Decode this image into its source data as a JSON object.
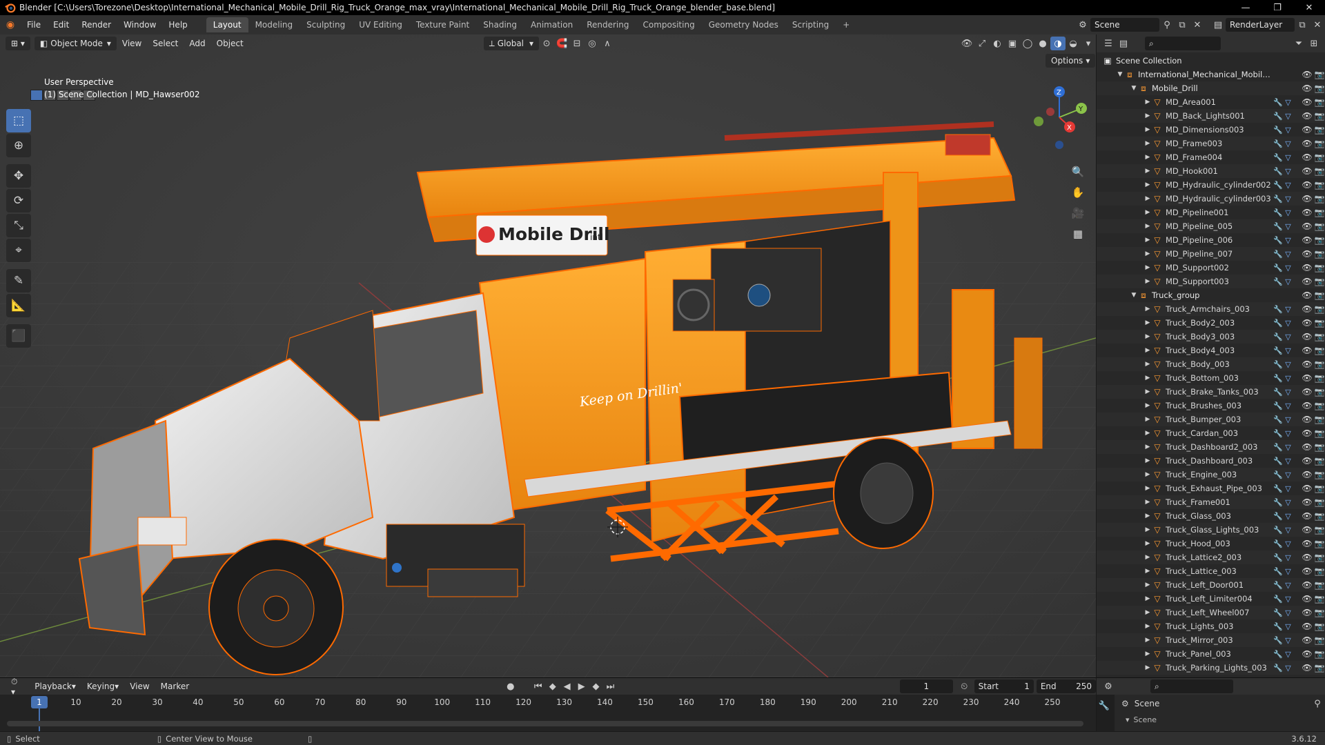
{
  "window": {
    "title": "Blender [C:\\Users\\Torezone\\Desktop\\International_Mechanical_Mobile_Drill_Rig_Truck_Orange_max_vray\\International_Mechanical_Mobile_Drill_Rig_Truck_Orange_blender_base.blend]"
  },
  "menu": [
    "File",
    "Edit",
    "Render",
    "Window",
    "Help"
  ],
  "workspaces": [
    "Layout",
    "Modeling",
    "Sculpting",
    "UV Editing",
    "Texture Paint",
    "Shading",
    "Animation",
    "Rendering",
    "Compositing",
    "Geometry Nodes",
    "Scripting"
  ],
  "active_workspace": "Layout",
  "scene_field": "Scene",
  "renderlayer_field": "RenderLayer",
  "viewport": {
    "mode": "Object Mode",
    "menus": [
      "View",
      "Select",
      "Add",
      "Object"
    ],
    "transform_orientation": "Global",
    "options_label": "Options",
    "info_line1": "User Perspective",
    "info_line2": "(1) Scene Collection | MD_Hawser002",
    "logo_text": "Mobile Drill",
    "logo_suffix": "intl",
    "door_text": "Keep on Drillin'",
    "gizmo": {
      "z": "Z",
      "y": "Y",
      "x": "X"
    }
  },
  "outliner": {
    "root": "Scene Collection",
    "items": [
      {
        "label": "International_Mechanical_Mobile_Drill_R",
        "depth": 1,
        "type": "collection",
        "expanded": true
      },
      {
        "label": "Mobile_Drill",
        "depth": 2,
        "type": "collection",
        "expanded": true
      },
      {
        "label": "MD_Area001",
        "depth": 3,
        "type": "object"
      },
      {
        "label": "MD_Back_Lights001",
        "depth": 3,
        "type": "object"
      },
      {
        "label": "MD_Dimensions003",
        "depth": 3,
        "type": "object"
      },
      {
        "label": "MD_Frame003",
        "depth": 3,
        "type": "object"
      },
      {
        "label": "MD_Frame004",
        "depth": 3,
        "type": "object"
      },
      {
        "label": "MD_Hook001",
        "depth": 3,
        "type": "object"
      },
      {
        "label": "MD_Hydraulic_cylinder002",
        "depth": 3,
        "type": "object"
      },
      {
        "label": "MD_Hydraulic_cylinder003",
        "depth": 3,
        "type": "object"
      },
      {
        "label": "MD_Pipeline001",
        "depth": 3,
        "type": "object"
      },
      {
        "label": "MD_Pipeline_005",
        "depth": 3,
        "type": "object"
      },
      {
        "label": "MD_Pipeline_006",
        "depth": 3,
        "type": "object"
      },
      {
        "label": "MD_Pipeline_007",
        "depth": 3,
        "type": "object"
      },
      {
        "label": "MD_Support002",
        "depth": 3,
        "type": "object"
      },
      {
        "label": "MD_Support003",
        "depth": 3,
        "type": "object"
      },
      {
        "label": "Truck_group",
        "depth": 2,
        "type": "collection",
        "expanded": true
      },
      {
        "label": "Truck_Armchairs_003",
        "depth": 3,
        "type": "object"
      },
      {
        "label": "Truck_Body2_003",
        "depth": 3,
        "type": "object"
      },
      {
        "label": "Truck_Body3_003",
        "depth": 3,
        "type": "object"
      },
      {
        "label": "Truck_Body4_003",
        "depth": 3,
        "type": "object"
      },
      {
        "label": "Truck_Body_003",
        "depth": 3,
        "type": "object"
      },
      {
        "label": "Truck_Bottom_003",
        "depth": 3,
        "type": "object"
      },
      {
        "label": "Truck_Brake_Tanks_003",
        "depth": 3,
        "type": "object"
      },
      {
        "label": "Truck_Brushes_003",
        "depth": 3,
        "type": "object"
      },
      {
        "label": "Truck_Bumper_003",
        "depth": 3,
        "type": "object"
      },
      {
        "label": "Truck_Cardan_003",
        "depth": 3,
        "type": "object"
      },
      {
        "label": "Truck_Dashboard2_003",
        "depth": 3,
        "type": "object"
      },
      {
        "label": "Truck_Dashboard_003",
        "depth": 3,
        "type": "object"
      },
      {
        "label": "Truck_Engine_003",
        "depth": 3,
        "type": "object"
      },
      {
        "label": "Truck_Exhaust_Pipe_003",
        "depth": 3,
        "type": "object"
      },
      {
        "label": "Truck_Frame001",
        "depth": 3,
        "type": "object"
      },
      {
        "label": "Truck_Glass_003",
        "depth": 3,
        "type": "object"
      },
      {
        "label": "Truck_Glass_Lights_003",
        "depth": 3,
        "type": "object"
      },
      {
        "label": "Truck_Hood_003",
        "depth": 3,
        "type": "object"
      },
      {
        "label": "Truck_Lattice2_003",
        "depth": 3,
        "type": "object"
      },
      {
        "label": "Truck_Lattice_003",
        "depth": 3,
        "type": "object"
      },
      {
        "label": "Truck_Left_Door001",
        "depth": 3,
        "type": "object"
      },
      {
        "label": "Truck_Left_Limiter004",
        "depth": 3,
        "type": "object"
      },
      {
        "label": "Truck_Left_Wheel007",
        "depth": 3,
        "type": "object"
      },
      {
        "label": "Truck_Lights_003",
        "depth": 3,
        "type": "object"
      },
      {
        "label": "Truck_Mirror_003",
        "depth": 3,
        "type": "object"
      },
      {
        "label": "Truck_Panel_003",
        "depth": 3,
        "type": "object"
      },
      {
        "label": "Truck_Parking_Lights_003",
        "depth": 3,
        "type": "object"
      }
    ]
  },
  "properties": {
    "scene_label": "Scene",
    "scene_sub": "Scene"
  },
  "timeline": {
    "menus": [
      "Playback",
      "Keying",
      "View",
      "Marker"
    ],
    "current_frame": "1",
    "start_label": "Start",
    "start": "1",
    "end_label": "End",
    "end": "250",
    "ticks": [
      "1",
      "10",
      "20",
      "30",
      "40",
      "50",
      "60",
      "70",
      "80",
      "90",
      "100",
      "110",
      "120",
      "130",
      "140",
      "150",
      "160",
      "170",
      "180",
      "190",
      "200",
      "210",
      "220",
      "230",
      "240",
      "250"
    ]
  },
  "status": {
    "left": "Select",
    "middle": "Center View to Mouse",
    "version": "3.6.12"
  },
  "colors": {
    "accent": "#4772b3",
    "selection_outline": "#ff7a1a",
    "truck_orange": "#ff9b1a",
    "header": "#303030"
  }
}
